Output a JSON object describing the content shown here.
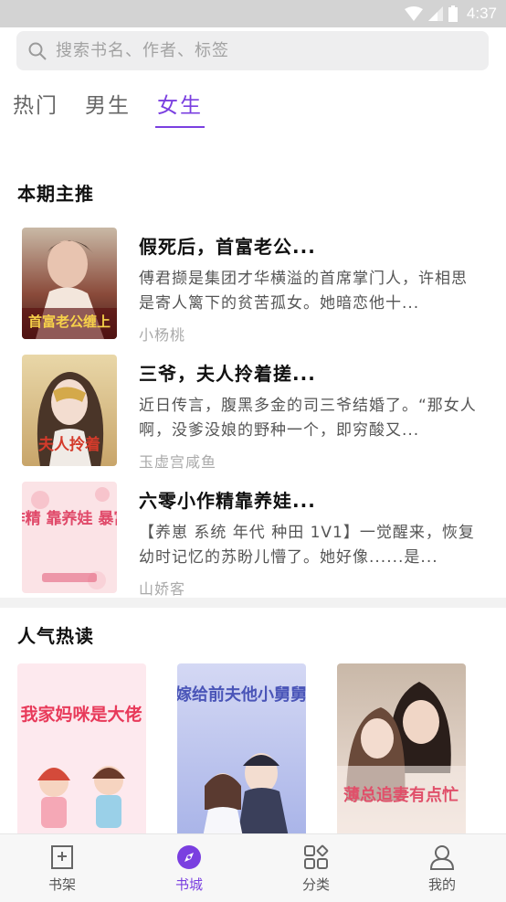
{
  "status_bar": {
    "time": "4:37"
  },
  "search": {
    "placeholder": "搜索书名、作者、标签"
  },
  "tabs": [
    {
      "label": "热门"
    },
    {
      "label": "男生"
    },
    {
      "label": "女生",
      "active": true
    }
  ],
  "featured": {
    "title": "本期主推",
    "books": [
      {
        "title": "假死后，首富老公...",
        "desc": "傅君撷是集团才华横溢的首席掌门人，许相思是寄人篱下的贫苦孤女。她暗恋他十...",
        "author": "小杨桃",
        "cover_text": "首富老公缠上"
      },
      {
        "title": "三爷，夫人拎着搓...",
        "desc": "近日传言，腹黑多金的司三爷结婚了。“那女人啊，没爹没娘的野种一个，即穷酸又...",
        "author": "玉虚宫咸鱼",
        "cover_text": "夫人拎着"
      },
      {
        "title": "六零小作精靠养娃...",
        "desc": "【养崽 系统 年代 种田 1V1】一觉醒来，恢复幼时记忆的苏盼儿懵了。她好像......是...",
        "author": "山娇客",
        "cover_text": "小作精 靠养娃 暴富了"
      }
    ]
  },
  "popular": {
    "title": "人气热读",
    "covers": [
      {
        "text": "我家妈咪是大佬"
      },
      {
        "text": "嫁给前夫他小舅舅"
      },
      {
        "text": "薄总追妻有点忙"
      }
    ]
  },
  "bottom_nav": [
    {
      "label": "书架",
      "icon": "bookmark-icon"
    },
    {
      "label": "书城",
      "icon": "compass-icon",
      "active": true
    },
    {
      "label": "分类",
      "icon": "category-icon"
    },
    {
      "label": "我的",
      "icon": "user-icon"
    }
  ],
  "colors": {
    "accent": "#7a3fe0",
    "status_bar": "#d3d3d3"
  }
}
